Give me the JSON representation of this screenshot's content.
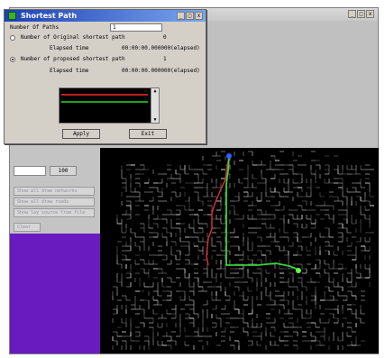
{
  "main_window": {
    "window_buttons": [
      "_",
      "□",
      "x"
    ],
    "field_b_value": "100",
    "side_buttons": [
      "Show all draw networks",
      "Show all draw roads",
      "Show lay source from file",
      "Clear"
    ]
  },
  "dialog": {
    "title": "Shortest Path",
    "window_buttons": [
      "_",
      "□",
      "x"
    ],
    "number_label": "Number Of Paths",
    "number_value": "1",
    "option1_label": "Number of Original shortest path",
    "option1_count": "0",
    "option1_sub_label": "Elapsed time",
    "option1_sub_value": "00:00:00.000000(elapsed)",
    "option2_label": "Number of proposed shortest path",
    "option2_count": "1",
    "option2_sub_label": "Elapsed time",
    "option2_sub_value": "00:00:00.000000(elapsed)",
    "apply_label": "Apply",
    "exit_label": "Exit",
    "path_colors": [
      "#c02020",
      "#20a020"
    ]
  },
  "map": {
    "background": "#000000",
    "road_color": "#d8d8d8",
    "original_path_color": "#d03030",
    "proposed_path_color": "#3cd03c",
    "start_marker_color": "#3060ff",
    "end_marker_color": "#60ff40"
  }
}
